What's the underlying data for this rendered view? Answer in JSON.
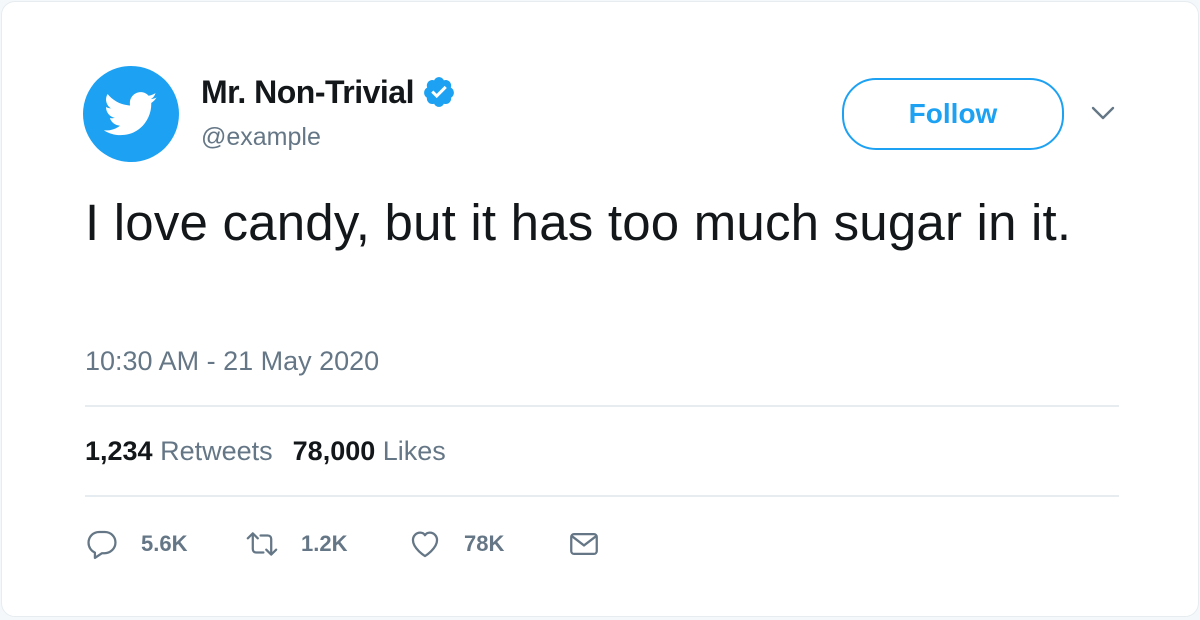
{
  "user": {
    "display_name": "Mr. Non-Trivial",
    "handle": "@example",
    "verified": true,
    "avatar_icon": "twitter-bird-icon"
  },
  "follow_button": {
    "label": "Follow"
  },
  "menu_icon": "chevron-down-icon",
  "tweet": {
    "text": "I love candy, but it has too much sugar in it.",
    "timestamp": "10:30 AM - 21 May 2020"
  },
  "stats": {
    "retweets_count": "1,234",
    "retweets_label": "Retweets",
    "likes_count": "78,000",
    "likes_label": "Likes"
  },
  "actions": {
    "reply_count": "5.6K",
    "retweet_count": "1.2K",
    "like_count": "78K"
  },
  "colors": {
    "brand_blue": "#1da1f2",
    "text_primary": "#14171a",
    "text_secondary": "#657786",
    "divider": "#e6ecf0"
  }
}
